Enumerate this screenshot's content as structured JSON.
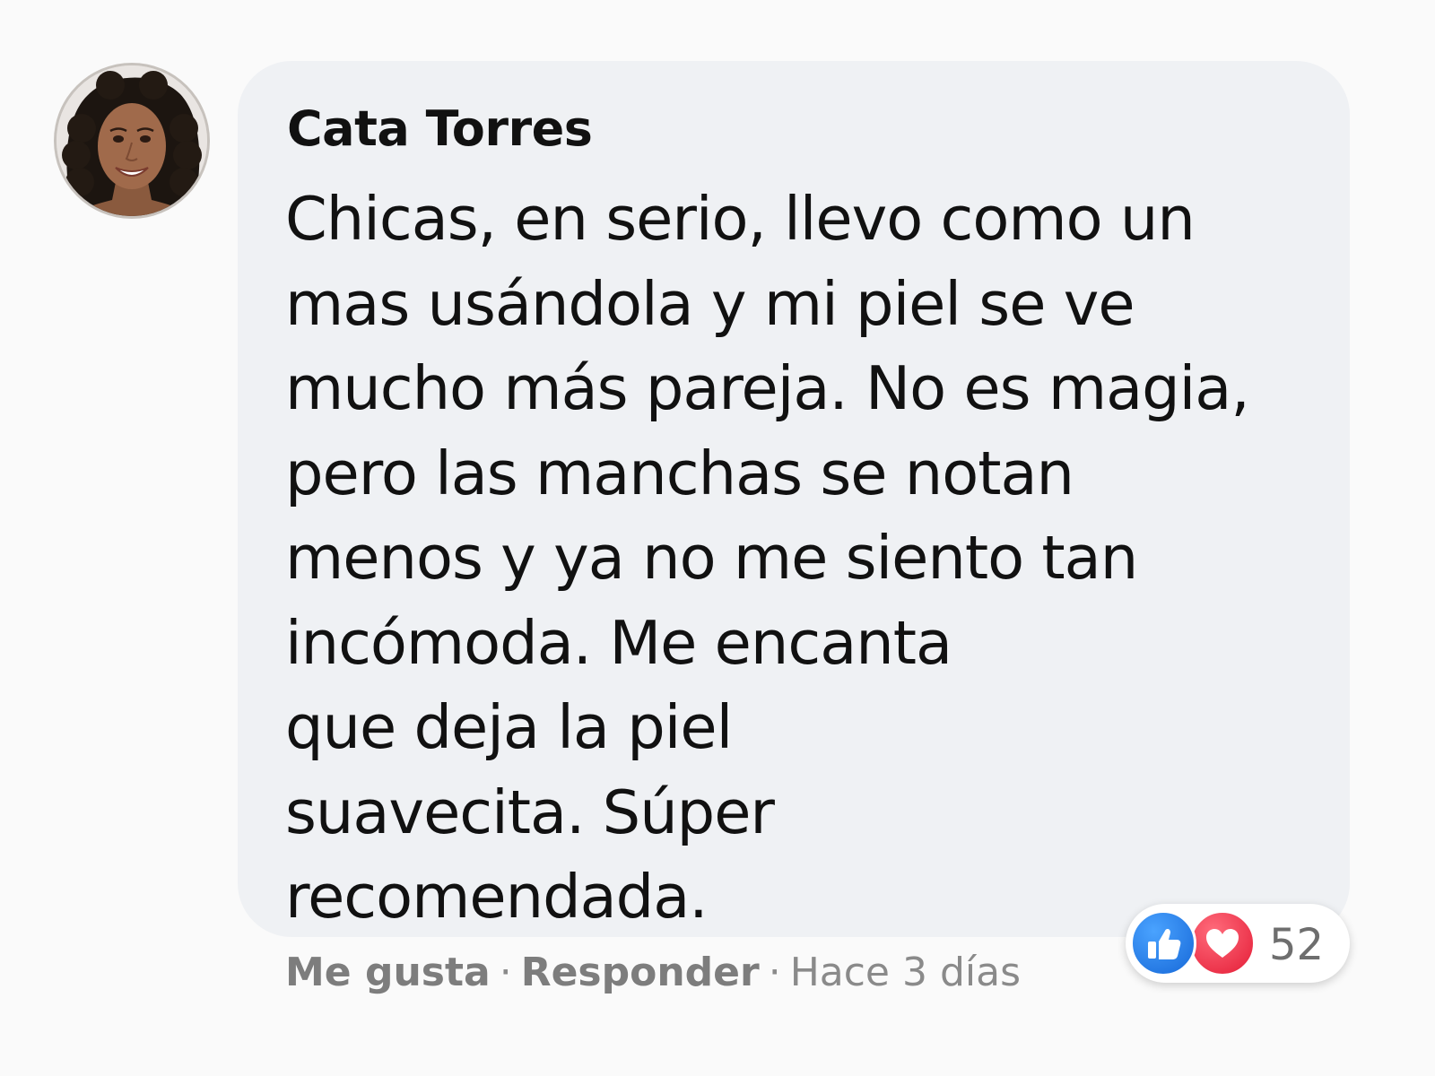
{
  "comment": {
    "author": "Cata Torres",
    "text_lines": [
      "Chicas, en serio, llevo como un",
      "mas usándola y mi piel se ve",
      "mucho más pareja. No es magia,",
      "pero las manchas se notan",
      "menos y ya no me siento tan",
      "incómoda. Me encanta",
      "que deja la piel",
      "suavecita. Súper",
      "recomendada."
    ]
  },
  "actions": {
    "like_label": "Me gusta",
    "separator": "·",
    "reply_label": "Responder",
    "timestamp": "Hace 3 días"
  },
  "reactions": {
    "icons": [
      "thumbs-up-icon",
      "heart-icon"
    ],
    "count": "52"
  },
  "colors": {
    "bubble_background": "#eff1f4",
    "like_blue": "#1877f2",
    "love_red": "#e41c36",
    "action_gray": "#7d7d7d"
  }
}
